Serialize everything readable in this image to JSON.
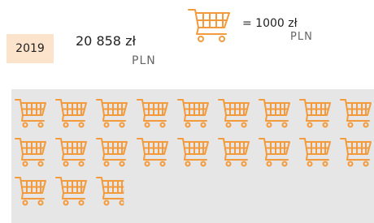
{
  "summary": {
    "year": "2019",
    "amount": "20 858 zł",
    "amount_currency": "PLN"
  },
  "legend": {
    "icon": "shopping-cart-icon",
    "value": "= 1000 zł",
    "currency": "PLN",
    "unit_per_icon": 1000
  },
  "carts": {
    "icon": "shopping-cart-icon",
    "count": 20.858,
    "per_row": 9,
    "color": "#f39a3c"
  }
}
